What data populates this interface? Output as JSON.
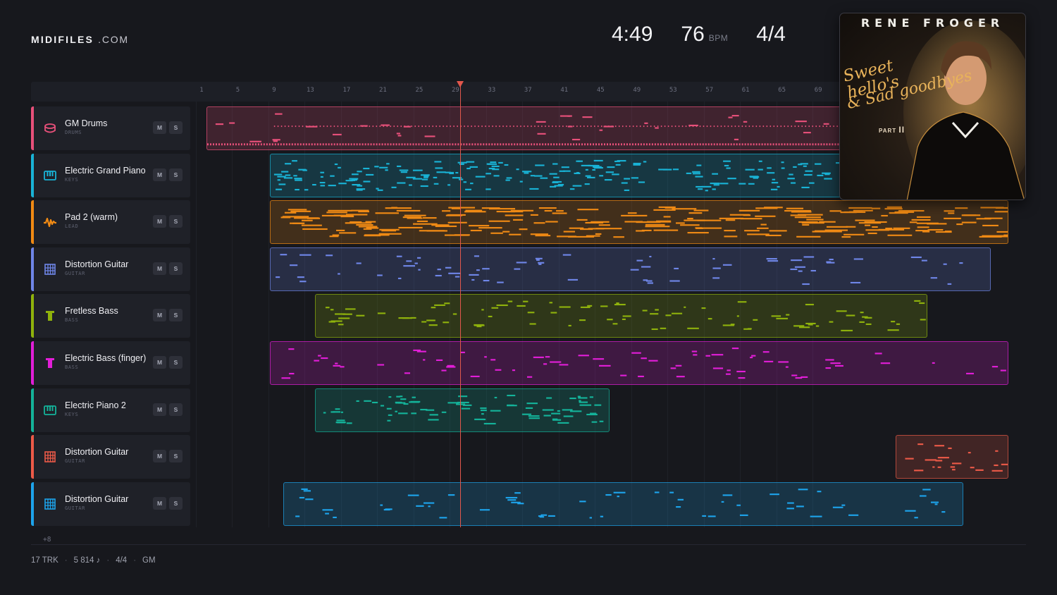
{
  "brand": {
    "name": "MIDIFILES",
    "suffix": ".COM"
  },
  "stats": {
    "time": "4:49",
    "bpm": "76",
    "bpm_unit": "BPM",
    "time_signature": "4/4"
  },
  "ruler": {
    "bars": [
      "1",
      "5",
      "9",
      "13",
      "17",
      "21",
      "25",
      "29",
      "33",
      "37",
      "41",
      "45",
      "49",
      "53",
      "57",
      "61",
      "65",
      "69"
    ]
  },
  "playhead_bar": 29.5,
  "tracks": [
    {
      "name": "GM Drums",
      "category": "DRUMS",
      "color": "#e8507a",
      "icon": "drum-icon",
      "mute": "M",
      "solo": "S"
    },
    {
      "name": "Electric Grand Piano",
      "category": "KEYS",
      "color": "#19b3d6",
      "icon": "piano-icon",
      "mute": "M",
      "solo": "S"
    },
    {
      "name": "Pad 2 (warm)",
      "category": "LEAD",
      "color": "#f08a14",
      "icon": "waveform-icon",
      "mute": "M",
      "solo": "S"
    },
    {
      "name": "Distortion Guitar",
      "category": "GUITAR",
      "color": "#6f86e8",
      "icon": "guitar-fretboard-icon",
      "mute": "M",
      "solo": "S"
    },
    {
      "name": "Fretless Bass",
      "category": "BASS",
      "color": "#8fb20c",
      "icon": "bass-icon",
      "mute": "M",
      "solo": "S"
    },
    {
      "name": "Electric Bass (finger)",
      "category": "BASS",
      "color": "#e21ed8",
      "icon": "bass-icon",
      "mute": "M",
      "solo": "S"
    },
    {
      "name": "Electric Piano 2",
      "category": "KEYS",
      "color": "#14b39a",
      "icon": "piano-icon",
      "mute": "M",
      "solo": "S"
    },
    {
      "name": "Distortion Guitar",
      "category": "GUITAR",
      "color": "#ec5a48",
      "icon": "guitar-fretboard-icon",
      "mute": "M",
      "solo": "S"
    },
    {
      "name": "Distortion Guitar",
      "category": "GUITAR",
      "color": "#1da4ec",
      "icon": "guitar-fretboard-icon",
      "mute": "M",
      "solo": "S"
    }
  ],
  "more_tracks": "+8",
  "footer": {
    "tracks": "17 TRK",
    "notes": "5 814 ♪",
    "meter": "4/4",
    "standard": "GM"
  },
  "cover": {
    "artist": "RENE FROGER",
    "title_line1": "Sweet hello's",
    "title_line2": "& Sad goodbyes",
    "part": "PART",
    "part_number": "II"
  }
}
